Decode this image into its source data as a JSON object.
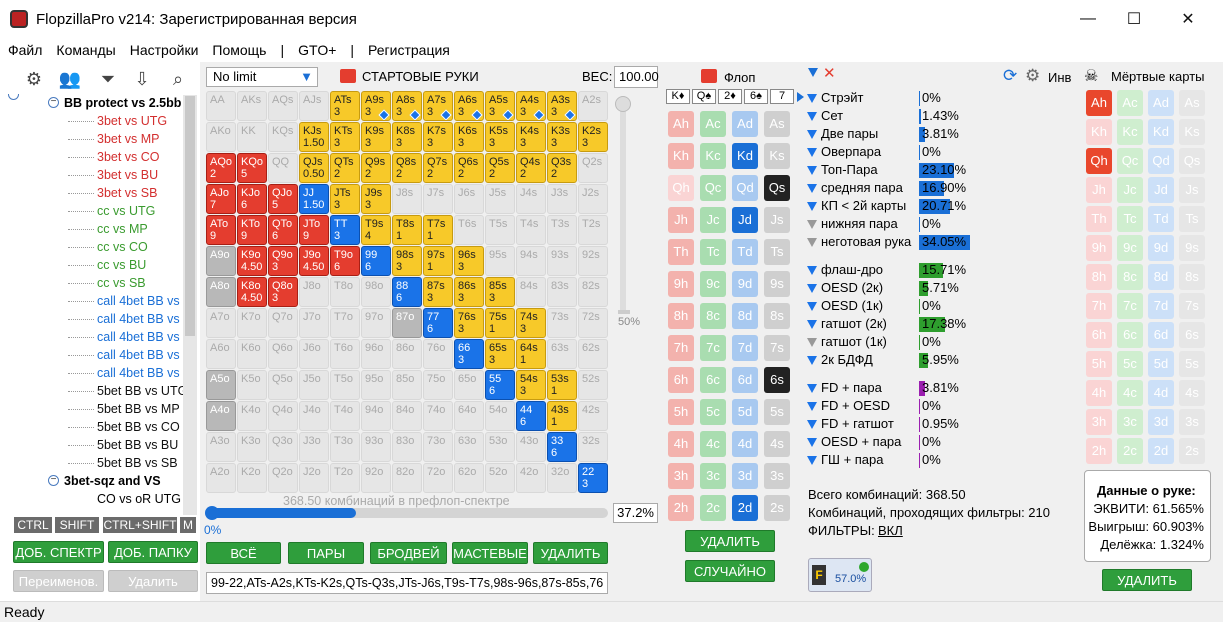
{
  "window": {
    "title": "FlopzillaPro v214: Зарегистрированная версия",
    "min": "—",
    "max": "☐",
    "close": "✕"
  },
  "menu": [
    "Файл",
    "Команды",
    "Настройки",
    "Помощь",
    "|",
    "GTO+",
    "|",
    "Регистрация"
  ],
  "tree": {
    "root": "BB protect vs 2.5bb",
    "items": [
      {
        "label": "3bet vs UTG",
        "color": "#d32f2f"
      },
      {
        "label": "3bet vs MP",
        "color": "#d32f2f"
      },
      {
        "label": "3bet vs CO",
        "color": "#d32f2f"
      },
      {
        "label": "3bet vs BU",
        "color": "#d32f2f"
      },
      {
        "label": "3bet vs SB",
        "color": "#d32f2f"
      },
      {
        "label": "cc vs UTG",
        "color": "#3a9b2f"
      },
      {
        "label": "cc vs MP",
        "color": "#3a9b2f"
      },
      {
        "label": "cc vs CO",
        "color": "#3a9b2f"
      },
      {
        "label": "cc vs BU",
        "color": "#3a9b2f"
      },
      {
        "label": "cc vs SB",
        "color": "#3a9b2f"
      },
      {
        "label": "call 4bet BB vs U",
        "color": "#1a6fd6"
      },
      {
        "label": "call 4bet BB vs M",
        "color": "#1a6fd6"
      },
      {
        "label": "call 4bet BB vs C",
        "color": "#1a6fd6"
      },
      {
        "label": "call 4bet BB vs B",
        "color": "#1a6fd6"
      },
      {
        "label": "call 4bet BB vs S",
        "color": "#1a6fd6"
      },
      {
        "label": "5bet BB vs UTG",
        "color": "#111"
      },
      {
        "label": "5bet BB vs MP",
        "color": "#111"
      },
      {
        "label": "5bet BB vs CO",
        "color": "#111"
      },
      {
        "label": "5bet BB vs BU",
        "color": "#111"
      },
      {
        "label": "5bet BB vs SB",
        "color": "#111"
      }
    ],
    "root2": "3bet-sqz and VS",
    "child2": "CO vs oR UTG"
  },
  "keys": {
    "ctrl": "CTRL",
    "shift": "SHIFT",
    "ctrlshift": "CTRL+SHIFT",
    "m": "M"
  },
  "left_buttons": {
    "add_spectrum": "ДОБ. СПЕКТР",
    "add_folder": "ДОБ. ПАПКУ",
    "rename": "Переименов.",
    "delete": "Удалить"
  },
  "range": {
    "limit": "No limit",
    "header": "СТАРТОВЫЕ РУКИ",
    "weight_label": "ВЕС:",
    "weight_value": "100.00",
    "combos_text": "368.50 комбинаций в префлоп-спектре",
    "progress_left": "0%",
    "progress_pct": "37.2%",
    "slider_pct": "50%",
    "range_string": "99-22,ATs-A2s,KTs-K2s,QTs-Q3s,JTs-J6s,T9s-T7s,98s-96s,87s-85s,76"
  },
  "range_buttons": {
    "all": "ВСЁ",
    "pairs": "ПАРЫ",
    "broadway": "БРОДВЕЙ",
    "suited": "МАСТЕВЫЕ",
    "delete": "УДАЛИТЬ"
  },
  "hands": [
    [
      "AA|g",
      "AKs|g",
      "AQs|g",
      "AJs|g",
      "ATs|y|3",
      "A9s|y|3|s",
      "A8s|y|3|s",
      "A7s|y|3|s",
      "A6s|y|3|s",
      "A5s|y|3|s",
      "A4s|y|3|s",
      "A3s|y|3|s",
      "A2s|g"
    ],
    [
      "AKo|g",
      "KK|g",
      "KQs|g",
      "KJs|y|1.50",
      "KTs|y|3",
      "K9s|y|3",
      "K8s|y|3",
      "K7s|y|3",
      "K6s|y|3",
      "K5s|y|3",
      "K4s|y|3",
      "K3s|y|3",
      "K2s|y|3"
    ],
    [
      "AQo|r|2",
      "KQo|r|5",
      "QQ|g",
      "QJs|y|0.50",
      "QTs|y|2",
      "Q9s|y|2",
      "Q8s|y|2",
      "Q7s|y|2",
      "Q6s|y|2",
      "Q5s|y|2",
      "Q4s|y|2",
      "Q3s|y|2",
      "Q2s|g"
    ],
    [
      "AJo|r|7",
      "KJo|r|6",
      "QJo|r|5",
      "JJ|b|1.50",
      "JTs|y|3",
      "J9s|y|3",
      "J8s|g",
      "J7s|g",
      "J6s|g",
      "J5s|g",
      "J4s|g",
      "J3s|g",
      "J2s|g"
    ],
    [
      "ATo|r|9",
      "KTo|r|9",
      "QTo|r|6",
      "JTo|r|9",
      "TT|b|3",
      "T9s|y|4",
      "T8s|y|1",
      "T7s|y|1",
      "T6s|g",
      "T5s|g",
      "T4s|g",
      "T3s|g",
      "T2s|g"
    ],
    [
      "A9o|gd",
      "K9o|r|4.50",
      "Q9o|r|3",
      "J9o|r|4.50",
      "T9o|r|6",
      "99|b|6",
      "98s|y|3",
      "97s|y|1",
      "96s|y|3",
      "95s|g",
      "94s|g",
      "93s|g",
      "92s|g"
    ],
    [
      "A8o|gd",
      "K8o|r|4.50",
      "Q8o|r|3",
      "J8o|g",
      "T8o|g",
      "98o|g",
      "88|b|6",
      "87s|y|3",
      "86s|y|3",
      "85s|y|3",
      "84s|g",
      "83s|g",
      "82s|g"
    ],
    [
      "A7o|g",
      "K7o|g",
      "Q7o|g",
      "J7o|g",
      "T7o|g",
      "97o|g",
      "87o|gd",
      "77|b|6",
      "76s|y|3",
      "75s|y|1",
      "74s|y|3",
      "73s|g",
      "72s|g"
    ],
    [
      "A6o|g",
      "K6o|g",
      "Q6o|g",
      "J6o|g",
      "T6o|g",
      "96o|g",
      "86o|g",
      "76o|g",
      "66|b|3",
      "65s|y|3",
      "64s|y|1",
      "63s|g",
      "62s|g"
    ],
    [
      "A5o|gd",
      "K5o|g",
      "Q5o|g",
      "J5o|g",
      "T5o|g",
      "95o|g",
      "85o|g",
      "75o|g",
      "65o|g",
      "55|b|6",
      "54s|y|3",
      "53s|y|1",
      "52s|g"
    ],
    [
      "A4o|gd",
      "K4o|g",
      "Q4o|g",
      "J4o|g",
      "T4o|g",
      "94o|g",
      "84o|g",
      "74o|g",
      "64o|g",
      "54o|g",
      "44|b|6",
      "43s|y|1",
      "42s|g"
    ],
    [
      "A3o|g",
      "K3o|g",
      "Q3o|g",
      "J3o|g",
      "T3o|g",
      "93o|g",
      "83o|g",
      "73o|g",
      "63o|g",
      "53o|g",
      "43o|g",
      "33|b|6",
      "32s|g"
    ],
    [
      "A2o|g",
      "K2o|g",
      "Q2o|g",
      "J2o|g",
      "T2o|g",
      "92o|g",
      "82o|g",
      "72o|g",
      "62o|g",
      "52o|g",
      "42o|g",
      "32o|g",
      "22|b|3"
    ]
  ],
  "flop": {
    "header": "Флоп",
    "board": [
      "K♦",
      "Q♠",
      "2♦",
      "6♠",
      "7"
    ],
    "delete": "УДАЛИТЬ",
    "random": "СЛУЧАЙНО",
    "filter_pct": "57.0%"
  },
  "deck": [
    [
      "Ah|hs",
      "Ac|cs",
      "Ad|ds",
      "As|ss"
    ],
    [
      "Kh|hs",
      "Kc|cs",
      "Kd|sel-d",
      "Ks|ss"
    ],
    [
      "Qh|h",
      "Qc|cs",
      "Qd|ds",
      "Qs|sel-s"
    ],
    [
      "Jh|hs",
      "Jc|cs",
      "Jd|sel-d",
      "Js|ss"
    ],
    [
      "Th|hs",
      "Tc|cs",
      "Td|ds",
      "Ts|ss"
    ],
    [
      "9h|hs",
      "9c|cs",
      "9d|ds",
      "9s|ss"
    ],
    [
      "8h|hs",
      "8c|cs",
      "8d|ds",
      "8s|ss"
    ],
    [
      "7h|hs",
      "7c|cs",
      "7d|ds",
      "7s|ss"
    ],
    [
      "6h|hs",
      "6c|cs",
      "6d|ds",
      "6s|sel-s"
    ],
    [
      "5h|hs",
      "5c|cs",
      "5d|ds",
      "5s|ss"
    ],
    [
      "4h|hs",
      "4c|cs",
      "4d|ds",
      "4s|ss"
    ],
    [
      "3h|hs",
      "3c|cs",
      "3d|ds",
      "3s|ss"
    ],
    [
      "2h|hs",
      "2c|cs",
      "2d|sel-d",
      "2s|ss"
    ]
  ],
  "dead": {
    "header": "Мёртвые карты",
    "inv": "Инв",
    "delete": "УДАЛИТЬ",
    "cards": [
      [
        "Ah|sel-h",
        "Ac|c",
        "Ad|d",
        "As|s"
      ],
      [
        "Kh|h",
        "Kc|c",
        "Kd|d",
        "Ks|s"
      ],
      [
        "Qh|sel-h",
        "Qc|c",
        "Qd|d",
        "Qs|s"
      ],
      [
        "Jh|h",
        "Jc|c",
        "Jd|d",
        "Js|s"
      ],
      [
        "Th|h",
        "Tc|c",
        "Td|d",
        "Ts|s"
      ],
      [
        "9h|h",
        "9c|c",
        "9d|d",
        "9s|s"
      ],
      [
        "8h|h",
        "8c|c",
        "8d|d",
        "8s|s"
      ],
      [
        "7h|h",
        "7c|c",
        "7d|d",
        "7s|s"
      ],
      [
        "6h|h",
        "6c|c",
        "6d|d",
        "6s|s"
      ],
      [
        "5h|h",
        "5c|c",
        "5d|d",
        "5s|s"
      ],
      [
        "4h|h",
        "4c|c",
        "4d|d",
        "4s|s"
      ],
      [
        "3h|h",
        "3c|c",
        "3d|d",
        "3s|s"
      ],
      [
        "2h|h",
        "2c|c",
        "2d|d",
        "2s|s"
      ]
    ]
  },
  "stats": [
    {
      "label": "Стрэйт",
      "pct": "0%",
      "v": 0,
      "c": "#1a6fd6"
    },
    {
      "label": "Сет",
      "pct": "1.43%",
      "v": 1.43,
      "c": "#1a6fd6"
    },
    {
      "label": "Две пары",
      "pct": "3.81%",
      "v": 3.81,
      "c": "#1a6fd6"
    },
    {
      "label": "Оверпара",
      "pct": "0%",
      "v": 0,
      "c": "#1a6fd6"
    },
    {
      "label": "Топ-Пара",
      "pct": "23.10%",
      "v": 23.1,
      "c": "#1a6fd6"
    },
    {
      "label": "средняя пара",
      "pct": "16.90%",
      "v": 16.9,
      "c": "#1a6fd6"
    },
    {
      "label": "КП < 2й карты",
      "pct": "20.71%",
      "v": 20.71,
      "c": "#1a6fd6"
    },
    {
      "label": "нижняя пара",
      "pct": "0%",
      "v": 0,
      "c": "#1a6fd6",
      "gray": true
    },
    {
      "label": "неготовая рука",
      "pct": "34.05%",
      "v": 34.05,
      "c": "#1a6fd6",
      "gray": true
    },
    {
      "label": "флаш-дро",
      "pct": "15.71%",
      "v": 15.71,
      "c": "#2e9e2e"
    },
    {
      "label": "OESD (2к)",
      "pct": "5.71%",
      "v": 5.71,
      "c": "#2e9e2e"
    },
    {
      "label": "OESD (1к)",
      "pct": "0%",
      "v": 0,
      "c": "#2e9e2e"
    },
    {
      "label": "гатшот (2к)",
      "pct": "17.38%",
      "v": 17.38,
      "c": "#2e9e2e"
    },
    {
      "label": "гатшот (1к)",
      "pct": "0%",
      "v": 0,
      "c": "#2e9e2e",
      "gray": true
    },
    {
      "label": "2к БДФД",
      "pct": "5.95%",
      "v": 5.95,
      "c": "#2e9e2e",
      "gear": true
    },
    {
      "label": "FD + пара",
      "pct": "3.81%",
      "v": 3.81,
      "c": "#9b1fb0"
    },
    {
      "label": "FD + OESD",
      "pct": "0%",
      "v": 0,
      "c": "#9b1fb0"
    },
    {
      "label": "FD + гатшот",
      "pct": "0.95%",
      "v": 0.95,
      "c": "#9b1fb0"
    },
    {
      "label": "OESD + пара",
      "pct": "0%",
      "v": 0,
      "c": "#9b1fb0"
    },
    {
      "label": "ГШ + пара",
      "pct": "0%",
      "v": 0,
      "c": "#9b1fb0"
    }
  ],
  "summary": {
    "total": "Всего комбинаций: 368.50",
    "passing": "Комбинаций, проходящих фильтры: 210",
    "filters": "ФИЛЬТРЫ:",
    "filters_val": "ВКЛ"
  },
  "handdata": {
    "title": "Данные о руке:",
    "equity": "ЭКВИТИ: 61.565%",
    "wins": "Выигрыш: 60.903%",
    "split": "Делёжка: 1.324%"
  },
  "status": "Ready"
}
